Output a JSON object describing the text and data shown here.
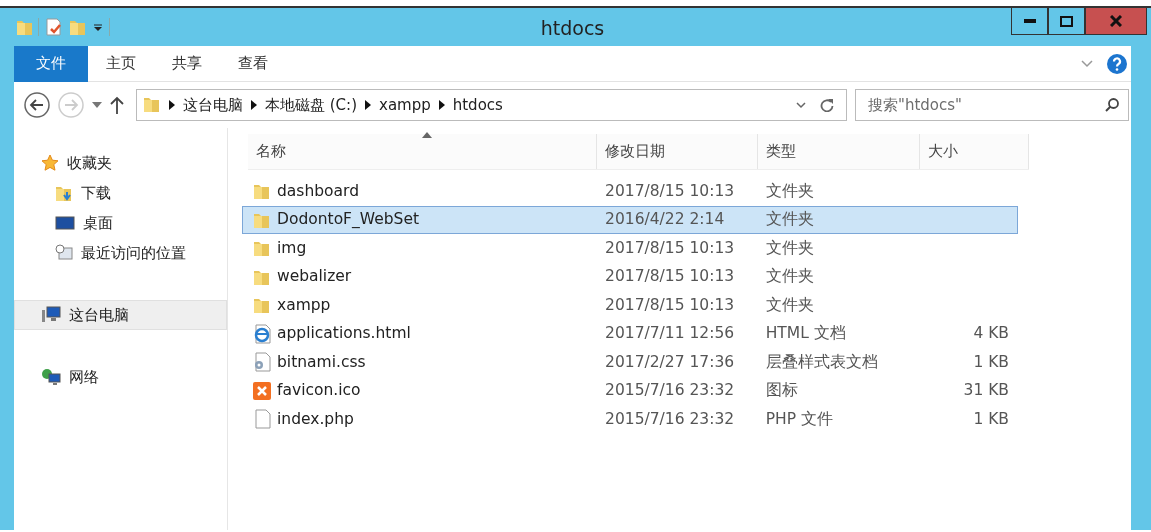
{
  "window": {
    "title": "htdocs"
  },
  "ribbon": {
    "tabs": [
      {
        "label": "文件",
        "selected": true
      },
      {
        "label": "主页",
        "selected": false
      },
      {
        "label": "共享",
        "selected": false
      },
      {
        "label": "查看",
        "selected": false
      }
    ]
  },
  "address": {
    "crumbs": [
      "这台电脑",
      "本地磁盘 (C:)",
      "xampp",
      "htdocs"
    ],
    "search_placeholder": "搜索\"htdocs\""
  },
  "sidebar": {
    "items": [
      {
        "label": "收藏夹",
        "kind": "star",
        "selected": false,
        "children": [
          {
            "label": "下载",
            "kind": "download",
            "selected": false
          },
          {
            "label": "桌面",
            "kind": "desktop",
            "selected": false
          },
          {
            "label": "最近访问的位置",
            "kind": "recent",
            "selected": false
          }
        ]
      },
      {
        "label": "这台电脑",
        "kind": "computer",
        "selected": true
      },
      {
        "label": "网络",
        "kind": "network",
        "selected": false
      }
    ]
  },
  "table": {
    "columns": [
      {
        "label": "名称",
        "sorted": true
      },
      {
        "label": "修改日期",
        "sorted": false
      },
      {
        "label": "类型",
        "sorted": false
      },
      {
        "label": "大小",
        "sorted": false
      }
    ],
    "rows": [
      {
        "name": "dashboard",
        "date": "2017/8/15 10:13",
        "type": "文件夹",
        "kind": "folder",
        "selected": false
      },
      {
        "name": "DodontoF_WebSet",
        "date": "2016/4/22 2:14",
        "type": "文件夹",
        "kind": "folder",
        "selected": true
      },
      {
        "name": "img",
        "date": "2017/8/15 10:13",
        "type": "文件夹",
        "kind": "folder",
        "selected": false
      },
      {
        "name": "webalizer",
        "date": "2017/8/15 10:13",
        "type": "文件夹",
        "kind": "folder",
        "selected": false
      },
      {
        "name": "xampp",
        "date": "2017/8/15 10:13",
        "type": "文件夹",
        "kind": "folder",
        "selected": false
      },
      {
        "name": "applications.html",
        "date": "2017/7/11 12:56",
        "type": "HTML 文档",
        "size": "4 KB",
        "kind": "html",
        "selected": false
      },
      {
        "name": "bitnami.css",
        "date": "2017/2/27 17:36",
        "type": "层叠样式表文档",
        "size": "1 KB",
        "kind": "css",
        "selected": false
      },
      {
        "name": "favicon.ico",
        "date": "2015/7/16 23:32",
        "type": "图标",
        "size": "31 KB",
        "kind": "ico",
        "selected": false
      },
      {
        "name": "index.php",
        "date": "2015/7/16 23:32",
        "type": "PHP 文件",
        "size": "1 KB",
        "kind": "file",
        "selected": false
      }
    ]
  }
}
